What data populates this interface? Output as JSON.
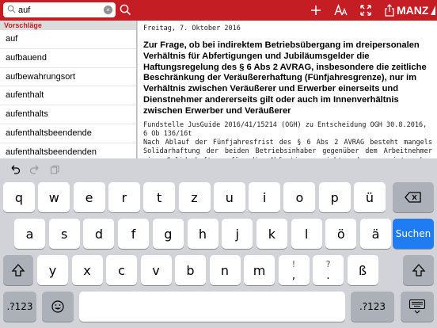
{
  "search": {
    "value": "auf",
    "clear_glyph": "×"
  },
  "toolbar": {
    "brand": "MANZ"
  },
  "suggestions": {
    "header": "Vorschläge",
    "items": [
      "auf",
      "aufbauend",
      "aufbewahrungsort",
      "aufenthalt",
      "aufenthalts",
      "aufenthaltsbeendende",
      "aufenthaltsbeendenden"
    ]
  },
  "article": {
    "date": "Freitag, 7. Oktober 2016",
    "headline": "Zur Frage, ob bei indirektem Betriebsübergang im dreipersonalen Verhältnis für Abfertigungen und Jubiläumsgelder die Haftungsregelung des § 6 Abs 2 AVRAG, insbesondere die zeitliche Beschränkung der Veräußererhaftung (Fünfjahresgrenze), nur im Verhältnis zwischen Veräußerer und Erwerber einerseits und Dienstnehmer andererseits gilt oder auch im Innenverhältnis zwischen Erwerber und Veräußerer",
    "source": "Fundstelle JusGuide 2016/41/15214 (OGH) zu Entscheidung OGH 30.8.2016, 6 Ob 136/16t",
    "body": "Nach Ablauf der Fünfjahresfrist des § 6 Abs 2 AVRAG besteht mangels Solidarhaftung der beiden Betriebsinhaber gegenüber dem Arbeitnehmer eine Solidarhaftung für die Abfertigung nicht mehr; es ist schon fraglich, ob überhaupt"
  },
  "keyboard": {
    "row1": [
      "q",
      "w",
      "e",
      "r",
      "t",
      "z",
      "u",
      "i",
      "o",
      "p",
      "ü"
    ],
    "row2": [
      "a",
      "s",
      "d",
      "f",
      "g",
      "h",
      "j",
      "k",
      "l",
      "ö",
      "ä"
    ],
    "row3": [
      "y",
      "x",
      "c",
      "v",
      "b",
      "n",
      "m"
    ],
    "row3_dual": [
      {
        "top": "!",
        "bottom": ","
      },
      {
        "top": "?",
        "bottom": "."
      }
    ],
    "row3_extra": "ß",
    "numbers_label": ".?123",
    "search_label": "Suchen"
  },
  "colors": {
    "accent": "#c41e24",
    "key_blue": "#1f7cf3"
  }
}
